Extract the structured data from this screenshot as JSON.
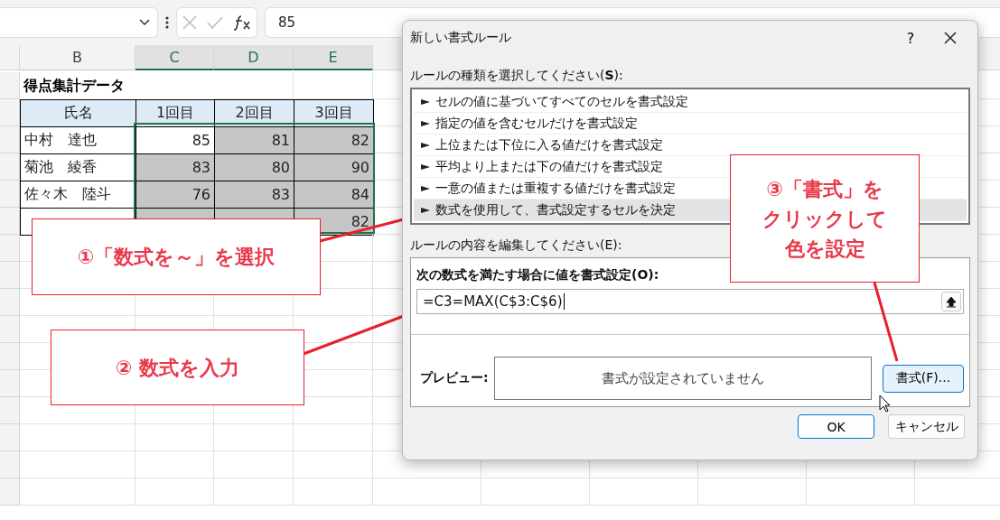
{
  "formula_bar": {
    "value": "85"
  },
  "sheet": {
    "columns": [
      {
        "label": "B",
        "selected": false
      },
      {
        "label": "C",
        "selected": true
      },
      {
        "label": "D",
        "selected": true
      },
      {
        "label": "E",
        "selected": true
      }
    ],
    "title": "得点集計データ",
    "header": [
      "氏名",
      "1回目",
      "2回目",
      "3回目"
    ],
    "rows": [
      {
        "name": "中村　達也",
        "scores": [
          {
            "value": "85",
            "shaded": false
          },
          {
            "value": "81",
            "shaded": true
          },
          {
            "value": "82",
            "shaded": true
          }
        ]
      },
      {
        "name": "菊池　綾香",
        "scores": [
          {
            "value": "83",
            "shaded": true
          },
          {
            "value": "80",
            "shaded": true
          },
          {
            "value": "90",
            "shaded": true
          }
        ]
      },
      {
        "name": "佐々木　陸斗",
        "scores": [
          {
            "value": "76",
            "shaded": true
          },
          {
            "value": "83",
            "shaded": true
          },
          {
            "value": "84",
            "shaded": true
          }
        ]
      },
      {
        "scores": [
          {
            "shaded": true
          },
          {
            "shaded": true
          },
          {
            "value": "82",
            "shaded": true
          }
        ]
      }
    ]
  },
  "dialog": {
    "title": "新しい書式ルール",
    "help": "?",
    "rule_type_label": "ルールの種類を選択してください(**S**):",
    "rule_types": [
      {
        "label": "セルの値に基づいてすべてのセルを書式設定",
        "selected": false
      },
      {
        "label": "指定の値を含むセルだけを書式設定",
        "selected": false
      },
      {
        "label": "上位または下位に入る値だけを書式設定",
        "selected": false
      },
      {
        "label": "平均より上または下の値だけを書式設定",
        "selected": false
      },
      {
        "label": "一意の値または重複する値だけを書式設定",
        "selected": false
      },
      {
        "label": "数式を使用して、書式設定するセルを決定",
        "selected": true
      }
    ],
    "edit_label": "ルールの内容を編集してください(E):",
    "formula_label": "次の数式を満たす場合に値を書式設定(O):",
    "formula": "=C3=MAX(C$3:C$6)",
    "preview_label": "プレビュー:",
    "preview_text": "書式が設定されていません",
    "format_button": "書式(F)...",
    "ok": "OK",
    "cancel": "キャンセル"
  },
  "callouts": [
    {
      "text": "①「数式を～」を選択"
    },
    {
      "text": "② 数式を入力"
    },
    {
      "lines": [
        "③「書式」を",
        "クリックして",
        "色を設定"
      ]
    }
  ]
}
